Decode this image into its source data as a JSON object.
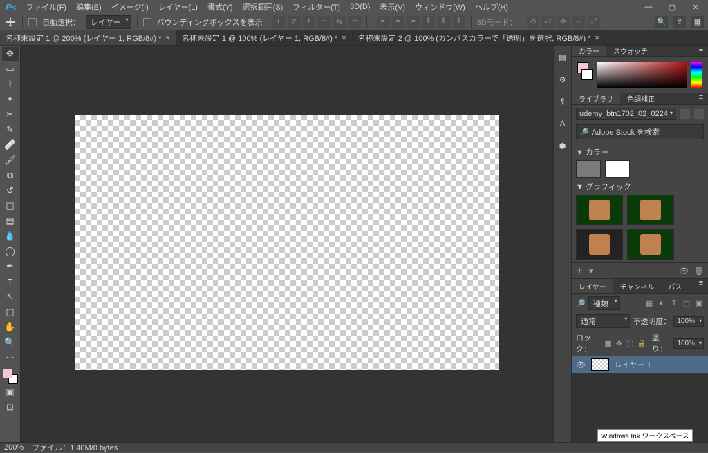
{
  "app": {
    "name": "Ps"
  },
  "menu": {
    "file": "ファイル(F)",
    "edit": "編集(E)",
    "image": "イメージ(I)",
    "layer": "レイヤー(L)",
    "type": "書式(Y)",
    "select": "選択範囲(S)",
    "filter": "フィルター(T)",
    "threed": "3D(D)",
    "view": "表示(V)",
    "window": "ウィンドウ(W)",
    "help": "ヘルプ(H)"
  },
  "options": {
    "auto_select_label": "自動選択：",
    "auto_select_target": "レイヤー",
    "show_bbox": "バウンディングボックスを表示",
    "mode3d_label": "3Dモード："
  },
  "tabs": [
    {
      "label": "名称未設定 1 @ 200% (レイヤー 1, RGB/8#) *",
      "active": true
    },
    {
      "label": "名称未設定 1 @ 100% (レイヤー 1, RGB/8#) *",
      "active": false
    },
    {
      "label": "名称未設定 2 @ 100% (カンバスカラーで「透明」を選択, RGB/8#) *",
      "active": false
    }
  ],
  "panels": {
    "color_tab": "カラー",
    "swatch_tab": "スウォッチ",
    "library_tab": "ライブラリ",
    "adjust_tab": "色調補正",
    "library_selected": "udemy_btn1702_02_0224",
    "search_placeholder": "Adobe Stock を検索",
    "section_color": "▼ カラー",
    "section_graphics": "▼ グラフィック",
    "lib_colors": [
      "#7a7a7a",
      "#ffffff"
    ]
  },
  "layers": {
    "tab_layers": "レイヤー",
    "tab_channels": "チャンネル",
    "tab_paths": "パス",
    "filter_kind": "種類",
    "blend_mode": "通常",
    "opacity_label": "不透明度：",
    "opacity_value": "100%",
    "lock_label": "ロック：",
    "fill_label": "塗り：",
    "fill_value": "100%",
    "item_name": "レイヤー 1"
  },
  "status": {
    "zoom": "200%",
    "doc_info": "ファイル：1.40M/0 bytes"
  },
  "tooltip": {
    "ink": "Windows Ink ワークスペース"
  }
}
